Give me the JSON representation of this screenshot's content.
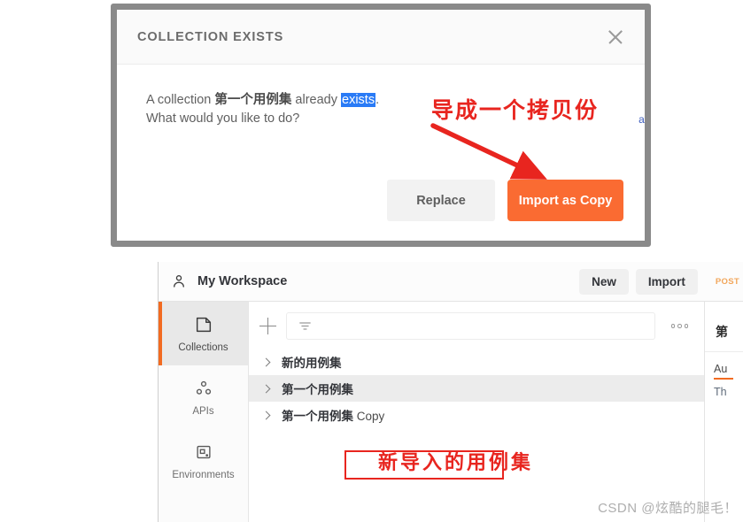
{
  "modal": {
    "title": "COLLECTION EXISTS",
    "close_icon": "close-icon",
    "message_prefix": "A collection ",
    "message_collection_name": "第一个用例集",
    "message_middle": " already ",
    "message_highlighted": "exists",
    "message_period": ".",
    "message_line2": "What would you like to do?",
    "replace_label": "Replace",
    "import_copy_label": "Import as Copy",
    "accent_color": "#fa6b32",
    "selection_color": "#2a7bf6"
  },
  "background_fragment": {
    "text": "a"
  },
  "annotations": {
    "top_text": "导成一个拷贝份",
    "bottom_text": "新导入的用例集",
    "color": "#e8251f",
    "arrow_icon": "arrow-down-right-icon",
    "highlight_box_icon": "red-rectangle-highlight"
  },
  "app": {
    "topbar": {
      "person_icon": "person-icon",
      "workspace_label": "My Workspace",
      "new_label": "New",
      "import_label": "Import",
      "method_fragment": "POST"
    },
    "rail": {
      "items": [
        {
          "label": "Collections",
          "icon": "collections-icon",
          "active": true
        },
        {
          "label": "APIs",
          "icon": "apis-icon",
          "active": false
        },
        {
          "label": "Environments",
          "icon": "environments-icon",
          "active": false
        }
      ],
      "active_indicator_color": "#f26b21"
    },
    "sidebar": {
      "new_icon": "plus-icon",
      "filter_icon": "filter-funnel-icon",
      "filter_placeholder": "",
      "more_icon": "more-options-icon",
      "collections": [
        {
          "name": "新的用例集",
          "suffix": "",
          "selected": false,
          "highlighted": false
        },
        {
          "name": "第一个用例集",
          "suffix": "",
          "selected": true,
          "highlighted": false
        },
        {
          "name": "第一个用例集",
          "suffix": " Copy",
          "selected": false,
          "highlighted": true
        }
      ]
    },
    "content_pane": {
      "title_fragment": "第",
      "tabs": [
        {
          "label": "Au",
          "active": true
        },
        {
          "label": "Th",
          "active": false
        }
      ]
    }
  },
  "watermark": {
    "text": "CSDN @炫酷的腿毛！"
  }
}
